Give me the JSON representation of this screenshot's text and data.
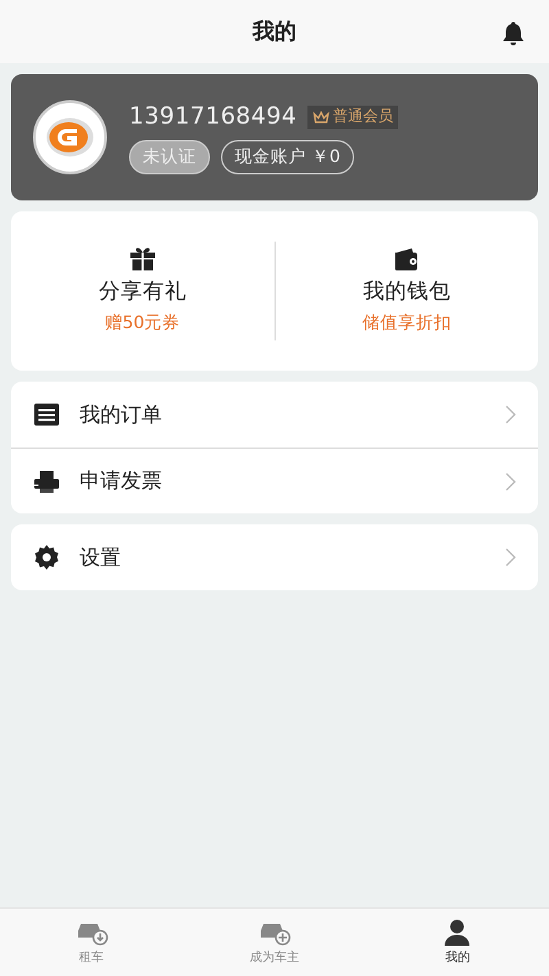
{
  "header": {
    "title": "我的"
  },
  "profile": {
    "phone": "13917168494",
    "member_level": "普通会员",
    "verification": "未认证",
    "cash_account": "现金账户 ￥0"
  },
  "promos": [
    {
      "kind": "gift",
      "title": "分享有礼",
      "subtitle": "赠50元券"
    },
    {
      "kind": "wallet",
      "title": "我的钱包",
      "subtitle": "储值享折扣"
    }
  ],
  "menu_groups": [
    [
      {
        "kind": "orders",
        "label": "我的订单"
      },
      {
        "kind": "invoice",
        "label": "申请发票"
      }
    ],
    [
      {
        "kind": "settings",
        "label": "设置"
      }
    ]
  ],
  "tab_bar": [
    {
      "kind": "rent",
      "label": "租车",
      "selected": false
    },
    {
      "kind": "owner",
      "label": "成为车主",
      "selected": false
    },
    {
      "kind": "me",
      "label": "我的",
      "selected": true
    }
  ]
}
